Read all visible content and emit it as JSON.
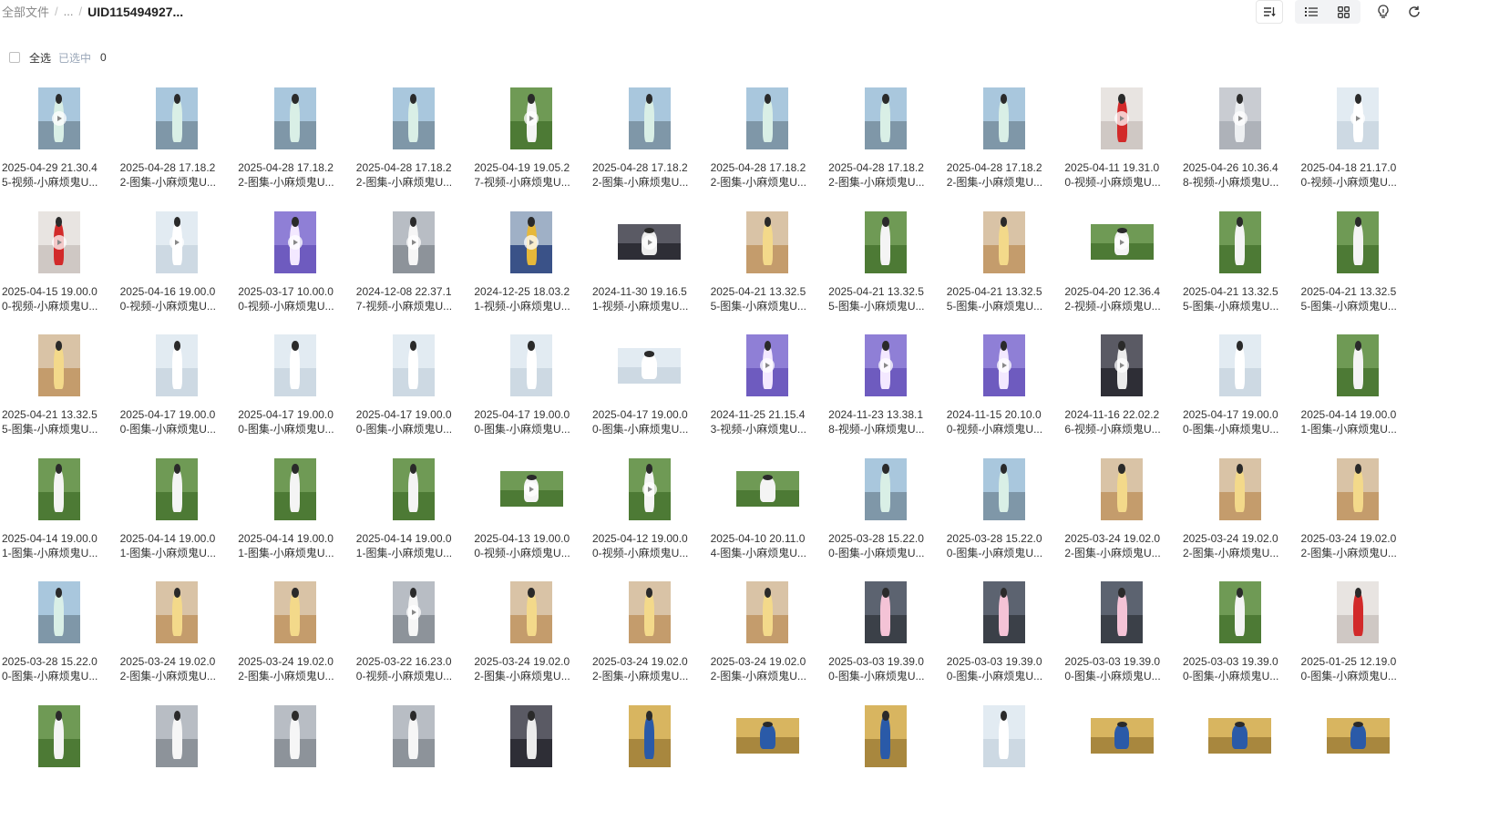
{
  "breadcrumb": {
    "root": "全部文件",
    "ellipsis": "...",
    "sep": "/",
    "current": "UID115494927..."
  },
  "toolbar": {
    "sort_icon": "sort-icon",
    "list_icon": "list-view-icon",
    "grid_icon": "grid-view-icon",
    "bulb_icon": "lightbulb-icon",
    "refresh_icon": "refresh-icon"
  },
  "selection": {
    "select_all": "全选",
    "selected_label": "已选中",
    "selected_count": "0"
  },
  "colors": {
    "accent": "#9aa7b8",
    "video_badge": "#ffffff"
  },
  "files": [
    {
      "line1": "2025-04-29 21.30.4",
      "line2": "5-视频-小麻烦鬼U...",
      "video": true,
      "orient": "p",
      "palette": "city"
    },
    {
      "line1": "2025-04-28 17.18.2",
      "line2": "2-图集-小麻烦鬼U...",
      "video": false,
      "orient": "p",
      "palette": "city"
    },
    {
      "line1": "2025-04-28 17.18.2",
      "line2": "2-图集-小麻烦鬼U...",
      "video": false,
      "orient": "p",
      "palette": "city"
    },
    {
      "line1": "2025-04-28 17.18.2",
      "line2": "2-图集-小麻烦鬼U...",
      "video": false,
      "orient": "p",
      "palette": "city"
    },
    {
      "line1": "2025-04-19 19.05.2",
      "line2": "7-视频-小麻烦鬼U...",
      "video": true,
      "orient": "p",
      "palette": "green"
    },
    {
      "line1": "2025-04-28 17.18.2",
      "line2": "2-图集-小麻烦鬼U...",
      "video": false,
      "orient": "p",
      "palette": "city"
    },
    {
      "line1": "2025-04-28 17.18.2",
      "line2": "2-图集-小麻烦鬼U...",
      "video": false,
      "orient": "p",
      "palette": "city"
    },
    {
      "line1": "2025-04-28 17.18.2",
      "line2": "2-图集-小麻烦鬼U...",
      "video": false,
      "orient": "p",
      "palette": "city"
    },
    {
      "line1": "2025-04-28 17.18.2",
      "line2": "2-图集-小麻烦鬼U...",
      "video": false,
      "orient": "p",
      "palette": "city"
    },
    {
      "line1": "2025-04-11 19.31.0",
      "line2": "0-视频-小麻烦鬼U...",
      "video": true,
      "orient": "p",
      "palette": "red"
    },
    {
      "line1": "2025-04-26 10.36.4",
      "line2": "8-视频-小麻烦鬼U...",
      "video": true,
      "orient": "p",
      "palette": "gray"
    },
    {
      "line1": "2025-04-18 21.17.0",
      "line2": "0-视频-小麻烦鬼U...",
      "video": true,
      "orient": "p",
      "palette": "pastel"
    },
    {
      "line1": "2025-04-15 19.00.0",
      "line2": "0-视频-小麻烦鬼U...",
      "video": true,
      "orient": "p",
      "palette": "red"
    },
    {
      "line1": "2025-04-16 19.00.0",
      "line2": "0-视频-小麻烦鬼U...",
      "video": true,
      "orient": "p",
      "palette": "pastel"
    },
    {
      "line1": "2025-03-17 10.00.0",
      "line2": "0-视频-小麻烦鬼U...",
      "video": true,
      "orient": "p",
      "palette": "purple"
    },
    {
      "line1": "2024-12-08 22.37.1",
      "line2": "7-视频-小麻烦鬼U...",
      "video": true,
      "orient": "p",
      "palette": "street"
    },
    {
      "line1": "2024-12-25 18.03.2",
      "line2": "1-视频-小麻烦鬼U...",
      "video": true,
      "orient": "p",
      "palette": "blue"
    },
    {
      "line1": "2024-11-30 19.16.5",
      "line2": "1-视频-小麻烦鬼U...",
      "video": true,
      "orient": "l",
      "palette": "dark"
    },
    {
      "line1": "2025-04-21 13.32.5",
      "line2": "5-图集-小麻烦鬼U...",
      "video": false,
      "orient": "p",
      "palette": "warm"
    },
    {
      "line1": "2025-04-21 13.32.5",
      "line2": "5-图集-小麻烦鬼U...",
      "video": false,
      "orient": "p",
      "palette": "green"
    },
    {
      "line1": "2025-04-21 13.32.5",
      "line2": "5-图集-小麻烦鬼U...",
      "video": false,
      "orient": "p",
      "palette": "warm"
    },
    {
      "line1": "2025-04-20 12.36.4",
      "line2": "2-视频-小麻烦鬼U...",
      "video": true,
      "orient": "l",
      "palette": "green"
    },
    {
      "line1": "2025-04-21 13.32.5",
      "line2": "5-图集-小麻烦鬼U...",
      "video": false,
      "orient": "p",
      "palette": "green"
    },
    {
      "line1": "2025-04-21 13.32.5",
      "line2": "5-图集-小麻烦鬼U...",
      "video": false,
      "orient": "p",
      "palette": "green"
    },
    {
      "line1": "2025-04-21 13.32.5",
      "line2": "5-图集-小麻烦鬼U...",
      "video": false,
      "orient": "p",
      "palette": "warm"
    },
    {
      "line1": "2025-04-17 19.00.0",
      "line2": "0-图集-小麻烦鬼U...",
      "video": false,
      "orient": "p",
      "palette": "pastel"
    },
    {
      "line1": "2025-04-17 19.00.0",
      "line2": "0-图集-小麻烦鬼U...",
      "video": false,
      "orient": "p",
      "palette": "pastel"
    },
    {
      "line1": "2025-04-17 19.00.0",
      "line2": "0-图集-小麻烦鬼U...",
      "video": false,
      "orient": "p",
      "palette": "pastel"
    },
    {
      "line1": "2025-04-17 19.00.0",
      "line2": "0-图集-小麻烦鬼U...",
      "video": false,
      "orient": "p",
      "palette": "pastel"
    },
    {
      "line1": "2025-04-17 19.00.0",
      "line2": "0-图集-小麻烦鬼U...",
      "video": false,
      "orient": "l",
      "palette": "pastel"
    },
    {
      "line1": "2024-11-25 21.15.4",
      "line2": "3-视频-小麻烦鬼U...",
      "video": true,
      "orient": "p",
      "palette": "purple"
    },
    {
      "line1": "2024-11-23 13.38.1",
      "line2": "8-视频-小麻烦鬼U...",
      "video": true,
      "orient": "p",
      "palette": "purple"
    },
    {
      "line1": "2024-11-15 20.10.0",
      "line2": "0-视频-小麻烦鬼U...",
      "video": true,
      "orient": "p",
      "palette": "purple"
    },
    {
      "line1": "2024-11-16 22.02.2",
      "line2": "6-视频-小麻烦鬼U...",
      "video": true,
      "orient": "p",
      "palette": "dark"
    },
    {
      "line1": "2025-04-17 19.00.0",
      "line2": "0-图集-小麻烦鬼U...",
      "video": false,
      "orient": "p",
      "palette": "pastel"
    },
    {
      "line1": "2025-04-14 19.00.0",
      "line2": "1-图集-小麻烦鬼U...",
      "video": false,
      "orient": "p",
      "palette": "green"
    },
    {
      "line1": "2025-04-14 19.00.0",
      "line2": "1-图集-小麻烦鬼U...",
      "video": false,
      "orient": "p",
      "palette": "green"
    },
    {
      "line1": "2025-04-14 19.00.0",
      "line2": "1-图集-小麻烦鬼U...",
      "video": false,
      "orient": "p",
      "palette": "green"
    },
    {
      "line1": "2025-04-14 19.00.0",
      "line2": "1-图集-小麻烦鬼U...",
      "video": false,
      "orient": "p",
      "palette": "green"
    },
    {
      "line1": "2025-04-14 19.00.0",
      "line2": "1-图集-小麻烦鬼U...",
      "video": false,
      "orient": "p",
      "palette": "green"
    },
    {
      "line1": "2025-04-13 19.00.0",
      "line2": "0-视频-小麻烦鬼U...",
      "video": true,
      "orient": "l",
      "palette": "green"
    },
    {
      "line1": "2025-04-12 19.00.0",
      "line2": "0-视频-小麻烦鬼U...",
      "video": true,
      "orient": "p",
      "palette": "green"
    },
    {
      "line1": "2025-04-10 20.11.0",
      "line2": "4-图集-小麻烦鬼U...",
      "video": false,
      "orient": "l",
      "palette": "green"
    },
    {
      "line1": "2025-03-28 15.22.0",
      "line2": "0-图集-小麻烦鬼U...",
      "video": false,
      "orient": "p",
      "palette": "city"
    },
    {
      "line1": "2025-03-28 15.22.0",
      "line2": "0-图集-小麻烦鬼U...",
      "video": false,
      "orient": "p",
      "palette": "city"
    },
    {
      "line1": "2025-03-24 19.02.0",
      "line2": "2-图集-小麻烦鬼U...",
      "video": false,
      "orient": "p",
      "palette": "warm"
    },
    {
      "line1": "2025-03-24 19.02.0",
      "line2": "2-图集-小麻烦鬼U...",
      "video": false,
      "orient": "p",
      "palette": "warm"
    },
    {
      "line1": "2025-03-24 19.02.0",
      "line2": "2-图集-小麻烦鬼U...",
      "video": false,
      "orient": "p",
      "palette": "warm"
    },
    {
      "line1": "2025-03-28 15.22.0",
      "line2": "0-图集-小麻烦鬼U...",
      "video": false,
      "orient": "p",
      "palette": "city"
    },
    {
      "line1": "2025-03-24 19.02.0",
      "line2": "2-图集-小麻烦鬼U...",
      "video": false,
      "orient": "p",
      "palette": "warm"
    },
    {
      "line1": "2025-03-24 19.02.0",
      "line2": "2-图集-小麻烦鬼U...",
      "video": false,
      "orient": "p",
      "palette": "warm"
    },
    {
      "line1": "2025-03-22 16.23.0",
      "line2": "0-视频-小麻烦鬼U...",
      "video": true,
      "orient": "p",
      "palette": "street"
    },
    {
      "line1": "2025-03-24 19.02.0",
      "line2": "2-图集-小麻烦鬼U...",
      "video": false,
      "orient": "p",
      "palette": "warm"
    },
    {
      "line1": "2025-03-24 19.02.0",
      "line2": "2-图集-小麻烦鬼U...",
      "video": false,
      "orient": "p",
      "palette": "warm"
    },
    {
      "line1": "2025-03-24 19.02.0",
      "line2": "2-图集-小麻烦鬼U...",
      "video": false,
      "orient": "p",
      "palette": "warm"
    },
    {
      "line1": "2025-03-03 19.39.0",
      "line2": "0-图集-小麻烦鬼U...",
      "video": false,
      "orient": "p",
      "palette": "subway"
    },
    {
      "line1": "2025-03-03 19.39.0",
      "line2": "0-图集-小麻烦鬼U...",
      "video": false,
      "orient": "p",
      "palette": "subway"
    },
    {
      "line1": "2025-03-03 19.39.0",
      "line2": "0-图集-小麻烦鬼U...",
      "video": false,
      "orient": "p",
      "palette": "subway"
    },
    {
      "line1": "2025-03-03 19.39.0",
      "line2": "0-图集-小麻烦鬼U...",
      "video": false,
      "orient": "p",
      "palette": "green"
    },
    {
      "line1": "2025-01-25 12.19.0",
      "line2": "0-图集-小麻烦鬼U...",
      "video": false,
      "orient": "p",
      "palette": "red"
    },
    {
      "line1": "",
      "line2": "",
      "video": false,
      "orient": "p",
      "palette": "green"
    },
    {
      "line1": "",
      "line2": "",
      "video": false,
      "orient": "p",
      "palette": "street"
    },
    {
      "line1": "",
      "line2": "",
      "video": false,
      "orient": "p",
      "palette": "street"
    },
    {
      "line1": "",
      "line2": "",
      "video": false,
      "orient": "p",
      "palette": "street"
    },
    {
      "line1": "",
      "line2": "",
      "video": false,
      "orient": "p",
      "palette": "dark"
    },
    {
      "line1": "",
      "line2": "",
      "video": false,
      "orient": "p",
      "palette": "yellowblue"
    },
    {
      "line1": "",
      "line2": "",
      "video": false,
      "orient": "l",
      "palette": "yellowblue"
    },
    {
      "line1": "",
      "line2": "",
      "video": false,
      "orient": "p",
      "palette": "yellowblue"
    },
    {
      "line1": "",
      "line2": "",
      "video": false,
      "orient": "p",
      "palette": "pastel"
    },
    {
      "line1": "",
      "line2": "",
      "video": false,
      "orient": "l",
      "palette": "yellowblue"
    },
    {
      "line1": "",
      "line2": "",
      "video": false,
      "orient": "l",
      "palette": "yellowblue"
    },
    {
      "line1": "",
      "line2": "",
      "video": false,
      "orient": "l",
      "palette": "yellowblue"
    }
  ]
}
